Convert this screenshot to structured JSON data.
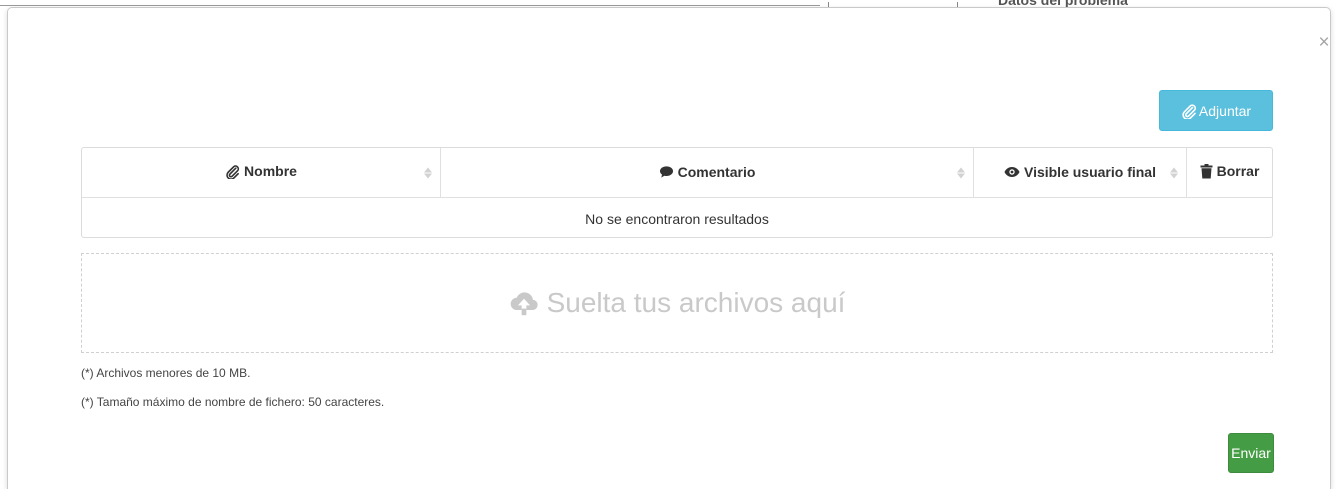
{
  "background": {
    "heading": "Datos del problema"
  },
  "modal": {
    "close_label": "×",
    "attach_label": "Adjuntar",
    "table": {
      "columns": [
        {
          "label": "Nombre",
          "icon": "paperclip-icon",
          "sortable": true
        },
        {
          "label": "Comentario",
          "icon": "comment-icon",
          "sortable": true
        },
        {
          "label": "Visible usuario final",
          "icon": "eye-icon",
          "sortable": true
        },
        {
          "label": "Borrar",
          "icon": "trash-icon",
          "sortable": false
        }
      ],
      "empty_message": "No se encontraron resultados"
    },
    "dropzone_label": "Suelta tus archivos aquí",
    "notes": [
      "(*) Archivos menores de 10 MB.",
      "(*) Tamaño máximo de nombre de fichero: 50 caracteres."
    ],
    "send_label": "Enviar"
  },
  "colors": {
    "info_button": "#5bc0de",
    "success_button": "#449d44",
    "dropzone_text": "#c9c9c9"
  }
}
